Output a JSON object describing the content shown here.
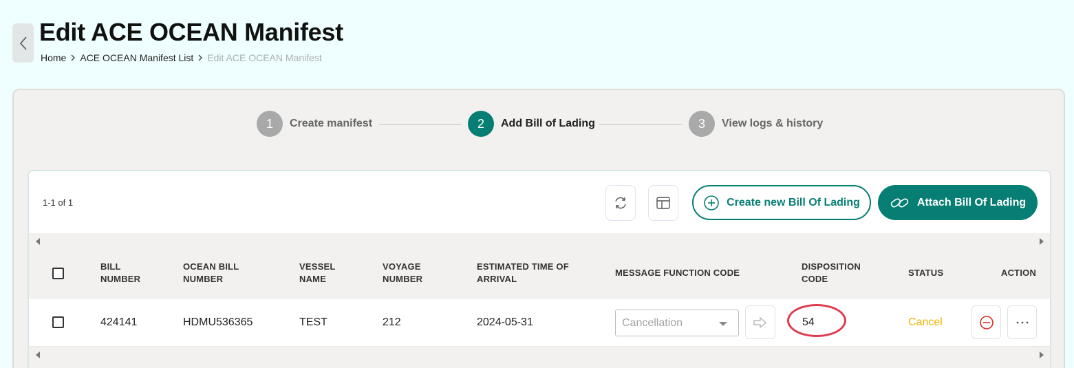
{
  "page": {
    "title": "Edit ACE OCEAN Manifest",
    "breadcrumb": [
      "Home",
      "ACE OCEAN Manifest List",
      "Edit ACE OCEAN Manifest"
    ]
  },
  "stepper": {
    "steps": [
      {
        "number": "1",
        "label": "Create manifest",
        "active": false
      },
      {
        "number": "2",
        "label": "Add Bill of Lading",
        "active": true
      },
      {
        "number": "3",
        "label": "View logs & history",
        "active": false
      }
    ]
  },
  "toolbar": {
    "record_count": "1-1 of 1",
    "refresh_icon": "refresh-icon",
    "layout_icon": "layout-icon",
    "create_button": "Create new Bill Of Lading",
    "attach_button": "Attach Bill Of Lading"
  },
  "table": {
    "headers": {
      "bill_number": [
        "BILL",
        "NUMBER"
      ],
      "ocean_bill_number": [
        "OCEAN BILL",
        "NUMBER"
      ],
      "vessel_name": [
        "VESSEL",
        "NAME"
      ],
      "voyage_number": [
        "VOYAGE",
        "NUMBER"
      ],
      "eta": [
        "ESTIMATED TIME OF",
        "ARRIVAL"
      ],
      "message_function_code": [
        "MESSAGE FUNCTION CODE"
      ],
      "disposition_code": [
        "DISPOSITION",
        "CODE"
      ],
      "status": [
        "STATUS"
      ],
      "action": [
        "ACTION"
      ]
    },
    "rows": [
      {
        "bill_number": "424141",
        "ocean_bill_number": "HDMU536365",
        "vessel_name": "TEST",
        "voyage_number": "212",
        "eta": "2024-05-31",
        "message_function_code": "Cancellation",
        "disposition_code": "54",
        "status": "Cancel"
      }
    ]
  },
  "colors": {
    "accent": "#067e73",
    "status_cancel": "#f0b400",
    "highlight_circle": "#e03a4e",
    "background": "#effefe"
  }
}
